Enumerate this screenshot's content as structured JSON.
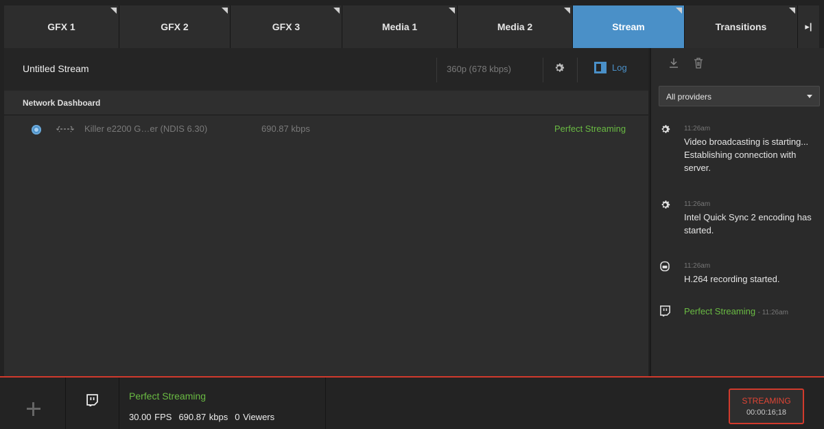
{
  "tabs": [
    {
      "label": "GFX 1",
      "active": false
    },
    {
      "label": "GFX 2",
      "active": false
    },
    {
      "label": "GFX 3",
      "active": false
    },
    {
      "label": "Media 1",
      "active": false
    },
    {
      "label": "Media 2",
      "active": false
    },
    {
      "label": "Stream",
      "active": true
    },
    {
      "label": "Transitions",
      "active": false
    }
  ],
  "tab_overflow_label": "▸|",
  "stream": {
    "title": "Untitled Stream",
    "quality": "360p (678 kbps)",
    "log_label": "Log"
  },
  "network": {
    "title": "Network Dashboard",
    "adapter": "Killer e2200 G…er (NDIS 6.30)",
    "rate": "690.87 kbps",
    "status": "Perfect Streaming"
  },
  "side": {
    "provider": "All providers",
    "log": [
      {
        "icon": "gear-icon",
        "time": "11:26am",
        "message": "Video broadcasting is starting... Establishing connection with server."
      },
      {
        "icon": "gear-icon",
        "time": "11:26am",
        "message": "Intel Quick Sync 2 encoding has started."
      },
      {
        "icon": "recording-icon",
        "time": "11:26am",
        "message": "H.264 recording started."
      },
      {
        "icon": "twitch-icon",
        "status": "Perfect Streaming",
        "time": "- 11:26am"
      }
    ]
  },
  "bottom": {
    "status": "Perfect Streaming",
    "fps": "30.00 FPS",
    "kbps": "690.87 kbps",
    "viewers": "0 Viewers",
    "stream_button_label": "STREAMING",
    "timecode": "00:00:16;18"
  },
  "colors": {
    "accent": "#4a90c8",
    "status_green": "#6abb43",
    "streaming_red": "#d23a2c"
  }
}
